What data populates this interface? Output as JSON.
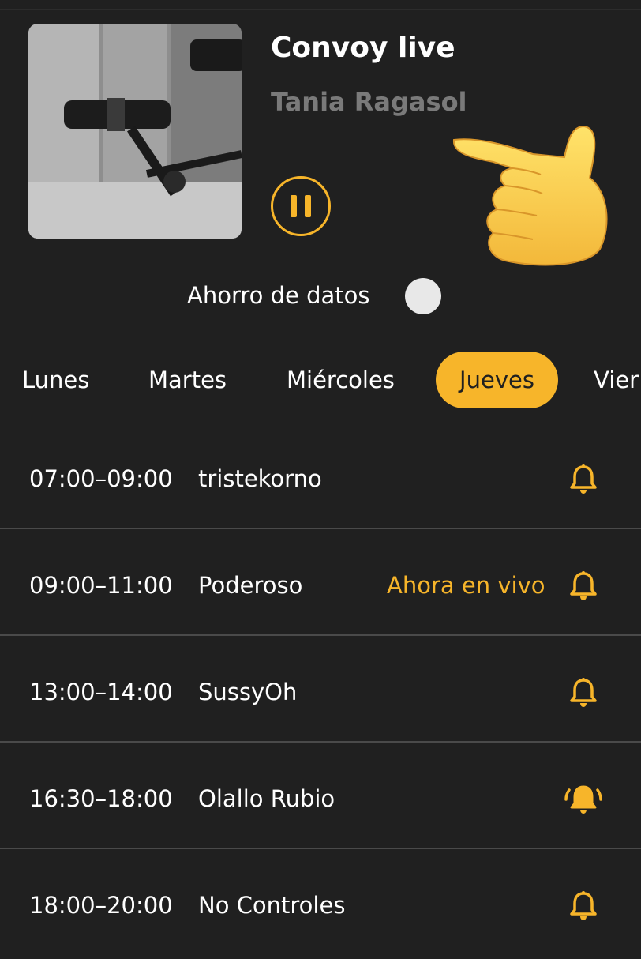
{
  "player": {
    "title": "Convoy live",
    "artist": "Tania Ragasol",
    "state_icon": "pause-icon"
  },
  "data_saver": {
    "label": "Ahorro de datos",
    "enabled": false
  },
  "colors": {
    "background": "#202020",
    "accent": "#f7b52a",
    "muted_text": "#7a7a7a",
    "divider": "#4a4a4a"
  },
  "days": {
    "tabs": [
      "Lunes",
      "Martes",
      "Miércoles",
      "Jueves",
      "Vier"
    ],
    "selected": "Jueves"
  },
  "schedule": [
    {
      "time": "07:00–09:00",
      "show": "tristekorno",
      "status": "",
      "bell": "bell-icon"
    },
    {
      "time": "09:00–11:00",
      "show": "Poderoso",
      "status": "Ahora en vivo",
      "bell": "bell-icon"
    },
    {
      "time": "13:00–14:00",
      "show": "SussyOh",
      "status": "",
      "bell": "bell-icon"
    },
    {
      "time": "16:30–18:00",
      "show": "Olallo Rubio",
      "status": "",
      "bell": "bell-ringing-icon"
    },
    {
      "time": "18:00–20:00",
      "show": "No Controles",
      "status": "",
      "bell": "bell-icon"
    }
  ]
}
